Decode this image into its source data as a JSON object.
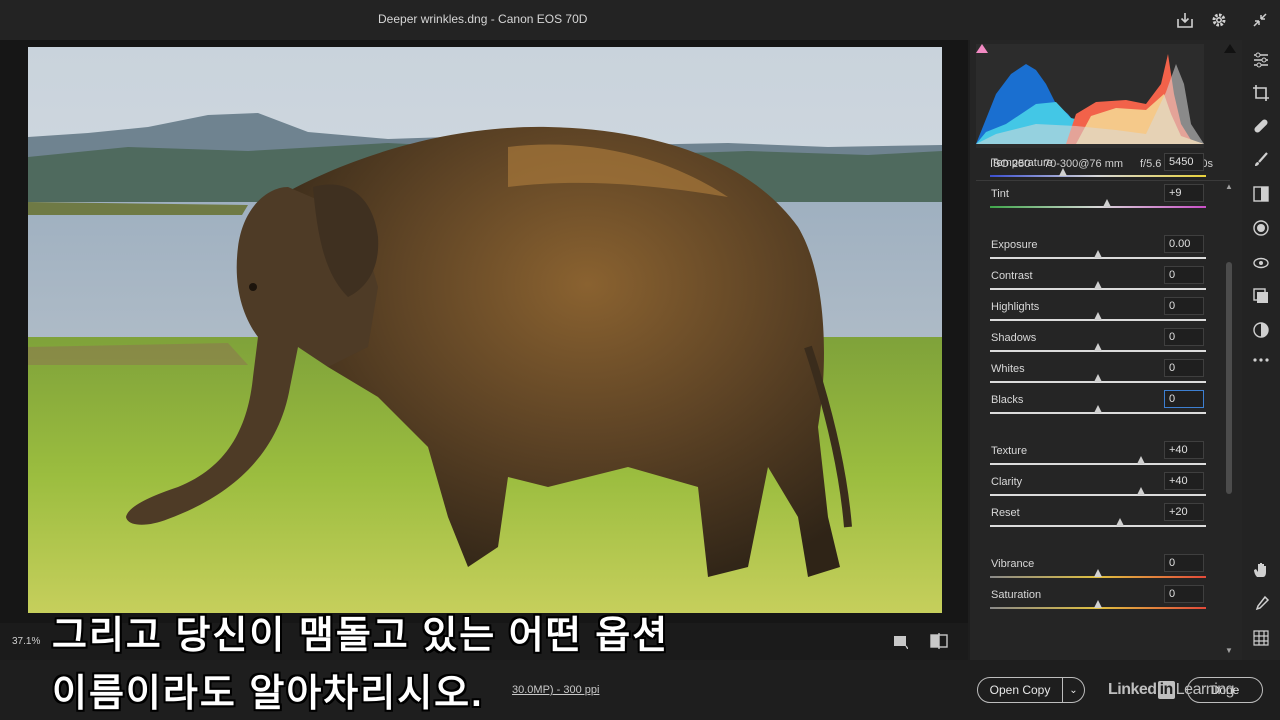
{
  "window": {
    "title": "Deeper wrinkles.dng  -  Canon EOS 70D"
  },
  "viewer": {
    "zoom": "37.1%",
    "file_info": "30.0MP) - 300 ppi"
  },
  "metadata": {
    "iso": "ISO 250",
    "lens": "70-300@76 mm",
    "aperture": "f/5.6",
    "shutter": "1/200s"
  },
  "sliders": [
    {
      "label": "Temperature",
      "value": "5450",
      "position": 0.34
    },
    {
      "label": "Tint",
      "value": "+9",
      "position": 0.54
    },
    {
      "label": "Exposure",
      "value": "0.00",
      "position": 0.5
    },
    {
      "label": "Contrast",
      "value": "0",
      "position": 0.5
    },
    {
      "label": "Highlights",
      "value": "0",
      "position": 0.5
    },
    {
      "label": "Shadows",
      "value": "0",
      "position": 0.5
    },
    {
      "label": "Whites",
      "value": "0",
      "position": 0.5
    },
    {
      "label": "Blacks",
      "value": "0",
      "position": 0.5
    },
    {
      "label": "Texture",
      "value": "+40",
      "position": 0.7
    },
    {
      "label": "Clarity",
      "value": "+40",
      "position": 0.7
    },
    {
      "label": "Reset",
      "value": "+20",
      "position": 0.6
    },
    {
      "label": "Vibrance",
      "value": "0",
      "position": 0.5
    },
    {
      "label": "Saturation",
      "value": "0",
      "position": 0.5
    }
  ],
  "buttons": {
    "open_copy": "Open Copy",
    "done": "Done"
  },
  "branding": {
    "linked": "Linked",
    "in": "in",
    "learning": "Learning"
  },
  "subtitles": {
    "line1": "그리고 당신이 맴돌고 있는 어떤 옵션",
    "line2": "이름이라도 알아차리시오."
  },
  "colors": {
    "accent": "#3d7fd1",
    "histogram_blue": "#1a6fd0",
    "histogram_cyan": "#43c7e6",
    "histogram_red": "#f2624a",
    "histogram_yellow": "#f5c98a"
  }
}
